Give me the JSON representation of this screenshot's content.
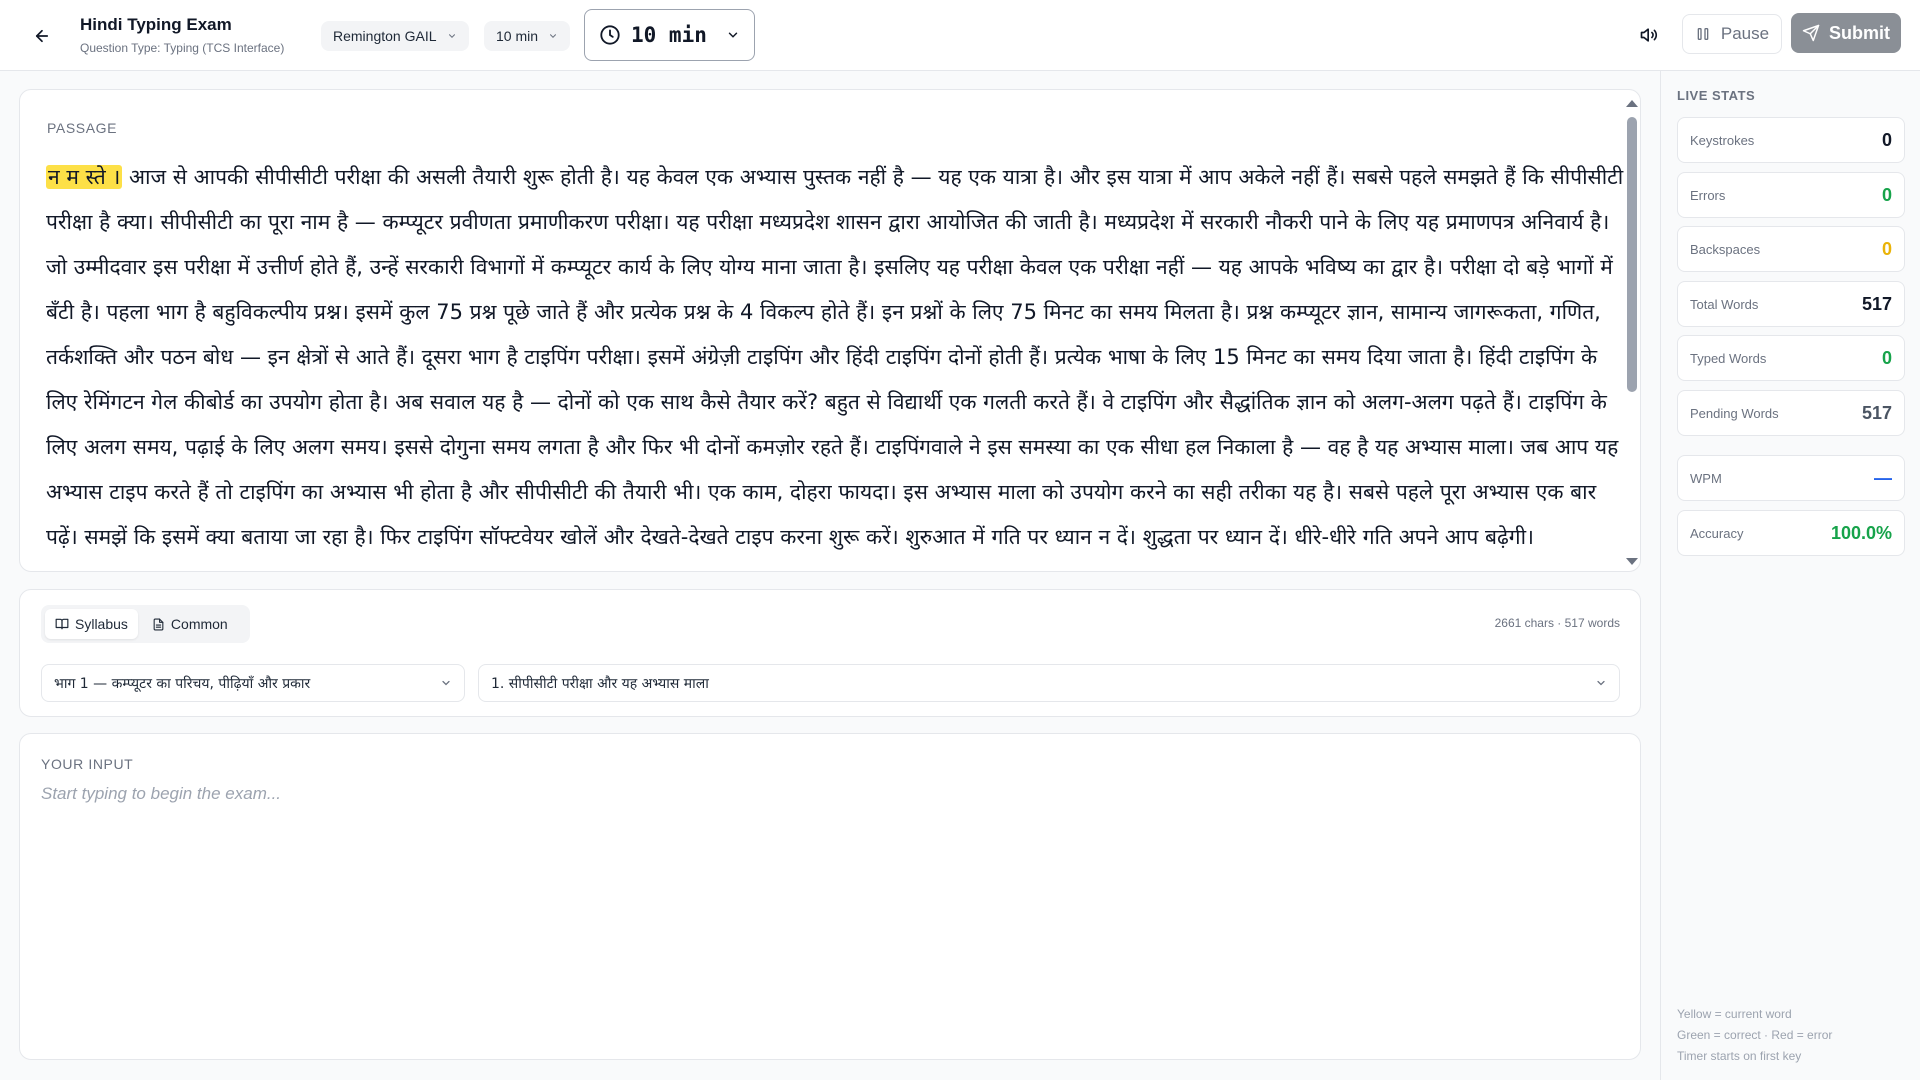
{
  "header": {
    "title": "Hindi Typing Exam",
    "subtitle": "Question Type: Typing (TCS Interface)",
    "layout_select": "Remington GAIL",
    "duration_select": "10 min",
    "timer": "10 min",
    "pause_label": "Pause",
    "submit_label": "Submit"
  },
  "passage": {
    "label": "PASSAGE",
    "current_word": "न म स्ते ।",
    "text": " आज से आपकी सीपीसीटी परीक्षा की असली तैयारी शुरू होती है। यह केवल एक अभ्यास पुस्तक नहीं है — यह एक यात्रा है। और इस यात्रा में आप अकेले नहीं हैं। सबसे पहले समझते हैं कि सीपीसीटी परीक्षा है क्या। सीपीसीटी का पूरा नाम है — कम्प्यूटर प्रवीणता प्रमाणीकरण परीक्षा। यह परीक्षा मध्यप्रदेश शासन द्वारा आयोजित की जाती है। मध्यप्रदेश में सरकारी नौकरी पाने के लिए यह प्रमाणपत्र अनिवार्य है। जो उम्मीदवार इस परीक्षा में उत्तीर्ण होते हैं, उन्हें सरकारी विभागों में कम्प्यूटर कार्य के लिए योग्य माना जाता है। इसलिए यह परीक्षा केवल एक परीक्षा नहीं — यह आपके भविष्य का द्वार है। परीक्षा दो बड़े भागों में बँटी है। पहला भाग है बहुविकल्पीय प्रश्न। इसमें कुल 75 प्रश्न पूछे जाते हैं और प्रत्येक प्रश्न के 4 विकल्प होते हैं। इन प्रश्नों के लिए 75 मिनट का समय मिलता है। प्रश्न कम्प्यूटर ज्ञान, सामान्य जागरूकता, गणित, तर्कशक्ति और पठन बोध — इन क्षेत्रों से आते हैं। दूसरा भाग है टाइपिंग परीक्षा। इसमें अंग्रेज़ी टाइपिंग और हिंदी टाइपिंग दोनों होती हैं। प्रत्येक भाषा के लिए 15 मिनट का समय दिया जाता है। हिंदी टाइपिंग के लिए रेमिंगटन गेल कीबोर्ड का उपयोग होता है। अब सवाल यह है — दोनों को एक साथ कैसे तैयार करें? बहुत से विद्यार्थी एक गलती करते हैं। वे टाइपिंग और सैद्धांतिक ज्ञान को अलग-अलग पढ़ते हैं। टाइपिंग के लिए अलग समय, पढ़ाई के लिए अलग समय। इससे दोगुना समय लगता है और फिर भी दोनों कमज़ोर रहते हैं। टाइपिंगवाले ने इस समस्या का एक सीधा हल निकाला है — वह है यह अभ्यास माला। जब आप यह अभ्यास टाइप करते हैं तो टाइपिंग का अभ्यास भी होता है और सीपीसीटी की तैयारी भी। एक काम, दोहरा फायदा। इस अभ्यास माला को उपयोग करने का सही तरीका यह है। सबसे पहले पूरा अभ्यास एक बार पढ़ें। समझें कि इसमें क्या बताया जा रहा है। फिर टाइपिंग सॉफ्टवेयर खोलें और देखते-देखते टाइप करना शुरू करें। शुरुआत में गति पर ध्यान न दें। शुद्धता पर ध्यान दें। धीरे-धीरे गति अपने आप बढ़ेगी।"
  },
  "selector": {
    "tab_syllabus": "Syllabus",
    "tab_common": "Common",
    "counts": "2661 chars · 517 words",
    "part_value": "भाग 1 — कम्प्यूटर का परिचय, पीढ़ियाँ और प्रकार",
    "lesson_value": "1. सीपीसीटी परीक्षा और यह अभ्यास माला"
  },
  "input": {
    "label": "YOUR INPUT",
    "placeholder": "Start typing to begin the exam..."
  },
  "stats": {
    "label": "LIVE STATS",
    "items": [
      {
        "name": "Keystrokes",
        "value": "0",
        "color": "#111827"
      },
      {
        "name": "Errors",
        "value": "0",
        "color": "#16a34a"
      },
      {
        "name": "Backspaces",
        "value": "0",
        "color": "#eab308"
      },
      {
        "name": "Total Words",
        "value": "517",
        "color": "#111827"
      },
      {
        "name": "Typed Words",
        "value": "0",
        "color": "#16a34a"
      },
      {
        "name": "Pending Words",
        "value": "517",
        "color": "#4b5563"
      },
      {
        "name": "WPM",
        "value": "—",
        "color": "#2563eb"
      },
      {
        "name": "Accuracy",
        "value": "100.0%",
        "color": "#16a34a"
      }
    ]
  },
  "legend": {
    "line1": "Yellow = current word",
    "line2": "Green = correct · Red = error",
    "line3": "Timer starts on first key"
  },
  "colors": {
    "highlight": "#fde047",
    "submit_bg": "#8a8f96",
    "green": "#16a34a",
    "amber": "#eab308",
    "blue": "#2563eb"
  }
}
